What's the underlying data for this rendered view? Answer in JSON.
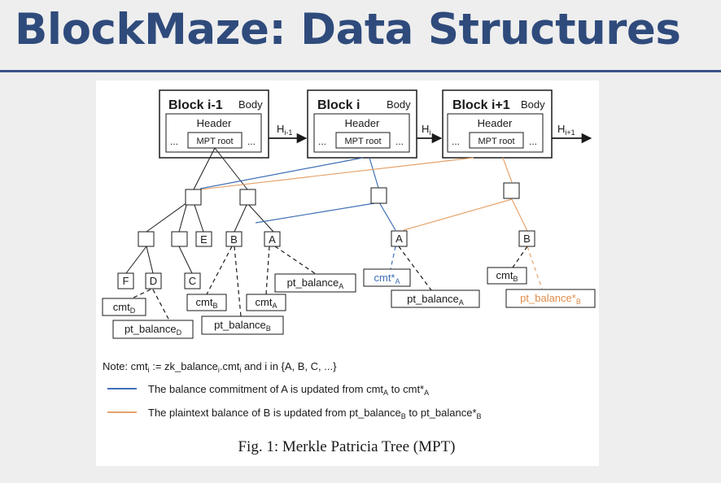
{
  "slide": {
    "title": "BlockMaze: Data Structures"
  },
  "blocks": [
    {
      "name": "Block i-1",
      "body": "Body",
      "header": "Header",
      "ellipsis": "...",
      "root": "MPT root",
      "hash_main": "H",
      "hash_sub": "i-1"
    },
    {
      "name": "Block i",
      "body": "Body",
      "header": "Header",
      "ellipsis": "...",
      "root": "MPT root",
      "hash_main": "H",
      "hash_sub": "i"
    },
    {
      "name": "Block i+1",
      "body": "Body",
      "header": "Header",
      "ellipsis": "...",
      "root": "MPT root",
      "hash_main": "H",
      "hash_sub": "i+1"
    }
  ],
  "tree": {
    "letters": {
      "f": "F",
      "d": "D",
      "e": "E",
      "c": "C",
      "b1": "B",
      "a1": "A",
      "a2": "A",
      "b2": "B"
    },
    "leaves": {
      "cmt_d": {
        "main": "cmt",
        "sub": "D",
        "suffix": ""
      },
      "pt_balance_d": {
        "main": "pt_balance",
        "sub": "D",
        "suffix": ""
      },
      "cmt_b": {
        "main": "cmt",
        "sub": "B",
        "suffix": ""
      },
      "pt_balance_b": {
        "main": "pt_balance",
        "sub": "B",
        "suffix": ""
      },
      "cmt_a": {
        "main": "cmt",
        "sub": "A",
        "suffix": ""
      },
      "pt_balance_a": {
        "main": "pt_balance",
        "sub": "A",
        "suffix": ""
      },
      "cmt_star_a": {
        "main": "cmt*",
        "sub": "A",
        "suffix": ""
      },
      "pt_balance_a2": {
        "main": "pt_balance",
        "sub": "A",
        "suffix": ""
      },
      "cmt_b2": {
        "main": "cmt",
        "sub": "B",
        "suffix": ""
      },
      "pt_balance_star_b": {
        "main": "pt_balance*",
        "sub": "B",
        "suffix": ""
      }
    }
  },
  "note": {
    "p1": "Note: cmt",
    "s1": "i",
    "p2": " := zk_balance",
    "s2": "i",
    "p3": ".cmt",
    "s3": "i",
    "p4": " and i in {A, B, C, ...}"
  },
  "legend": [
    {
      "color": "#3f6fb5",
      "p1": "The balance commitment of A is updated from cmt",
      "s1": "A",
      "p2": " to cmt*",
      "s2": "A"
    },
    {
      "color": "#e6a36c",
      "p1": "The plaintext balance of B is updated from pt_balance",
      "s1": "B",
      "p2": " to pt_balance*",
      "s2": "B"
    }
  ],
  "caption": "Fig. 1: Merkle Patricia Tree (MPT)",
  "colors": {
    "blue": "#3f6fb5",
    "orange": "#e6a36c",
    "title": "#2f4b7c"
  }
}
